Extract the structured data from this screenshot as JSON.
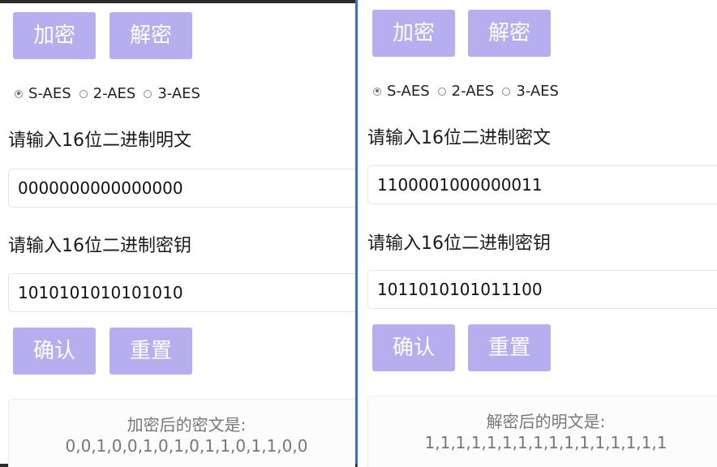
{
  "colors": {
    "button_bg": "#b7aef0",
    "separator": "#3f6fb8"
  },
  "left": {
    "encrypt_btn": "加密",
    "decrypt_btn": "解密",
    "modes": [
      "S-AES",
      "2-AES",
      "3-AES"
    ],
    "selected_mode": "S-AES",
    "text_label": "请输入16位二进制明文",
    "text_value": "0000000000000000",
    "key_label": "请输入16位二进制密钥",
    "key_value": "1010101010101010",
    "confirm_btn": "确认",
    "reset_btn": "重置",
    "result_title": "加密后的密文是:",
    "result_value": "0,0,1,0,0,1,0,1,0,1,1,0,1,1,0,0"
  },
  "right": {
    "encrypt_btn": "加密",
    "decrypt_btn": "解密",
    "modes": [
      "S-AES",
      "2-AES",
      "3-AES"
    ],
    "selected_mode": "S-AES",
    "text_label": "请输入16位二进制密文",
    "text_value": "1100001000000011",
    "key_label": "请输入16位二进制密钥",
    "key_value": "1011010101011100",
    "confirm_btn": "确认",
    "reset_btn": "重置",
    "result_title": "解密后的明文是:",
    "result_value": "1,1,1,1,1,1,1,1,1,1,1,1,1,1,1,1"
  }
}
